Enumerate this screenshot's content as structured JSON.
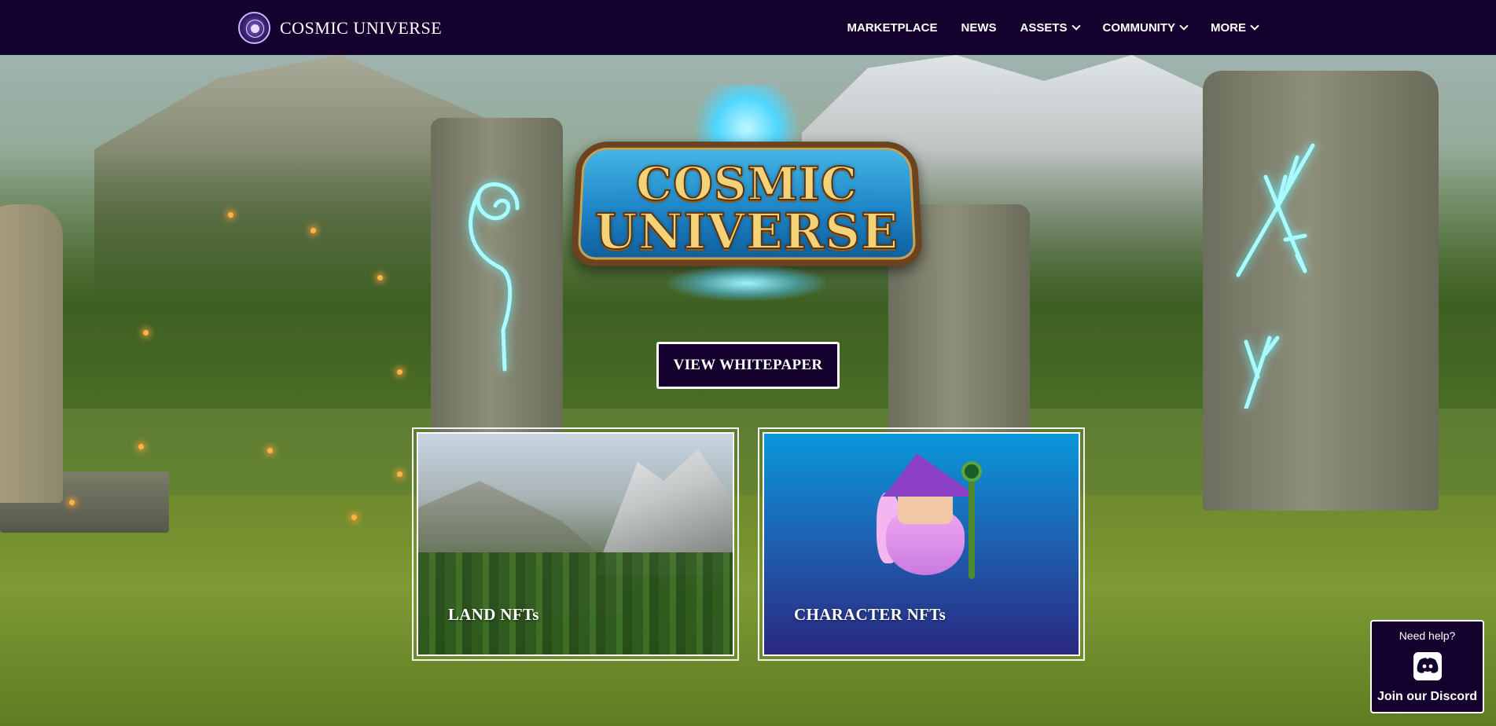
{
  "header": {
    "brand_name": "COSMIC UNIVERSE",
    "nav": [
      {
        "label": "MARKETPLACE",
        "dropdown": false
      },
      {
        "label": "NEWS",
        "dropdown": false
      },
      {
        "label": "ASSETS",
        "dropdown": true
      },
      {
        "label": "COMMUNITY",
        "dropdown": true
      },
      {
        "label": "MORE",
        "dropdown": true
      }
    ]
  },
  "hero": {
    "logo_line1": "COSMIC",
    "logo_line2": "UNIVERSE",
    "whitepaper_button": "VIEW WHITEPAPER"
  },
  "cards": [
    {
      "label": "LAND NFTs",
      "image": "forest-mountain-landscape"
    },
    {
      "label": "CHARACTER NFTs",
      "image": "wizard-character"
    }
  ],
  "discord_widget": {
    "help_text": "Need help?",
    "icon": "discord-icon",
    "join_text": "Join our Discord"
  },
  "colors": {
    "header_bg": "#14012e",
    "button_bg": "#14012e",
    "border": "#ffffff",
    "rune_glow": "#a8fbff"
  }
}
